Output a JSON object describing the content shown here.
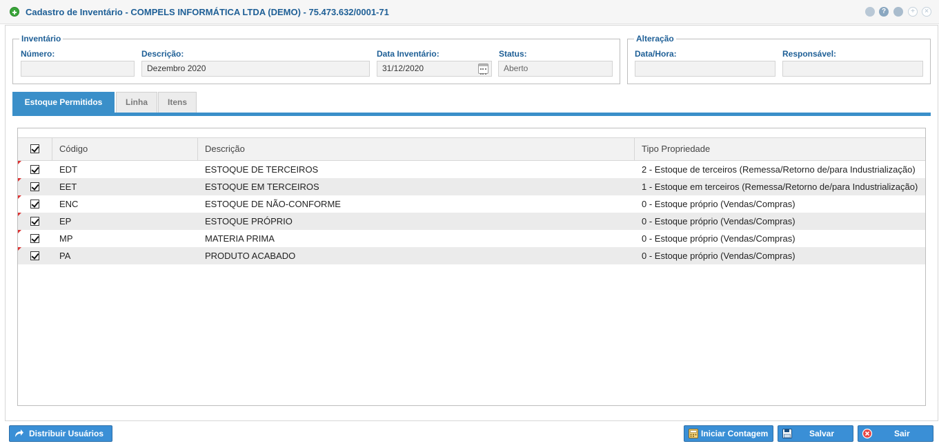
{
  "window": {
    "title": "Cadastro de Inventário - COMPELS INFORMÁTICA LTDA (DEMO) - 75.473.632/0001-71",
    "help_glyph": "?"
  },
  "inventario": {
    "legend": "Inventário",
    "numero_label": "Número:",
    "numero_value": "",
    "descricao_label": "Descrição:",
    "descricao_value": "Dezembro 2020",
    "data_label": "Data Inventário:",
    "data_value": "31/12/2020",
    "status_label": "Status:",
    "status_value": "Aberto"
  },
  "alteracao": {
    "legend": "Alteração",
    "datahora_label": "Data/Hora:",
    "datahora_value": "",
    "responsavel_label": "Responsável:",
    "responsavel_value": ""
  },
  "tabs": [
    {
      "label": "Estoque Permitidos",
      "active": true
    },
    {
      "label": "Linha",
      "active": false
    },
    {
      "label": "Itens",
      "active": false
    }
  ],
  "grid": {
    "headers": {
      "codigo": "Código",
      "descricao": "Descrição",
      "tipo": "Tipo Propriedade"
    },
    "rows": [
      {
        "checked": true,
        "codigo": "EDT",
        "descricao": "ESTOQUE DE TERCEIROS",
        "tipo": "2 - Estoque de terceiros (Remessa/Retorno de/para Industrialização)"
      },
      {
        "checked": true,
        "codigo": "EET",
        "descricao": "ESTOQUE EM TERCEIROS",
        "tipo": "1 - Estoque em terceiros (Remessa/Retorno de/para Industrialização)"
      },
      {
        "checked": true,
        "codigo": "ENC",
        "descricao": "ESTOQUE DE NÃO-CONFORME",
        "tipo": "0 - Estoque próprio (Vendas/Compras)"
      },
      {
        "checked": true,
        "codigo": "EP",
        "descricao": "ESTOQUE PRÓPRIO",
        "tipo": "0 - Estoque próprio (Vendas/Compras)"
      },
      {
        "checked": true,
        "codigo": "MP",
        "descricao": "MATERIA PRIMA",
        "tipo": "0 - Estoque próprio (Vendas/Compras)"
      },
      {
        "checked": true,
        "codigo": "PA",
        "descricao": "PRODUTO ACABADO",
        "tipo": "0 - Estoque próprio (Vendas/Compras)"
      }
    ]
  },
  "footer": {
    "distribuir_label": "Distribuir Usuários",
    "iniciar_label": "Iniciar Contagem",
    "salvar_label": "Salvar",
    "sair_label": "Sair"
  },
  "colors": {
    "accent": "#3a8fc9",
    "title_text": "#1e5f96",
    "button": "#3a8fd6"
  }
}
